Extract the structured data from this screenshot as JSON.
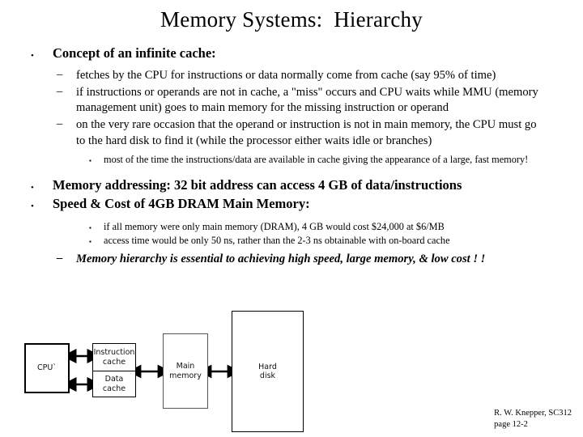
{
  "slide": {
    "title": "Memory Systems:  Hierarchy",
    "background_color": "#ffffff",
    "text_color": "#000000"
  },
  "bullets": {
    "b1": {
      "marker": "•",
      "text_plain": "Concept of an infinite cache:",
      "pre": "Concept of an ",
      "strong": "infinite cache",
      "post": ":"
    },
    "b2": {
      "marker": "–",
      "text": "fetches by the CPU for instructions or data normally come from cache (say 95% of time)"
    },
    "b3": {
      "marker": "–",
      "text": "if instructions or operands are not in cache, a \"miss\" occurs and CPU waits while MMU (memory management unit) goes to main memory for the missing instruction or operand"
    },
    "b4": {
      "marker": "–",
      "text": "on the very rare occasion that the operand or instruction is not in main memory, the CPU must go to the hard disk to find it (while the processor either waits idle or branches)"
    },
    "b5": {
      "marker": "▪",
      "text": "most of the time the instructions/data are available in cache giving the appearance of a large, fast memory!"
    },
    "b6": {
      "marker": "•",
      "text": "Memory addressing:  32 bit address can access 4 GB of data/instructions"
    },
    "b7": {
      "marker": "•",
      "text": "Speed & Cost of 4GB DRAM Main Memory:"
    },
    "b8": {
      "marker": "▪",
      "text": "if all memory were only main memory (DRAM), 4 GB  would cost $24,000 at $6/MB"
    },
    "b9": {
      "marker": "▪",
      "text": "access time would be only 50 ns, rather than the 2-3 ns obtainable with on-board cache"
    },
    "b10": {
      "marker": "–",
      "text": "Memory hierarchy is essential to achieving high speed, large memory, & low cost ! !"
    }
  },
  "diagram": {
    "cpu": {
      "label": "CPU`"
    },
    "instruction_cache": {
      "label": "Instruction\ncache"
    },
    "data_cache": {
      "label": "Data\ncache"
    },
    "main_memory": {
      "label": "Main\nmemory"
    },
    "hard_disk": {
      "label": "Hard\ndisk"
    },
    "connectors": [
      {
        "name": "cpu-to-instruction-cache",
        "type": "double-arrow"
      },
      {
        "name": "cpu-to-data-cache",
        "type": "double-arrow"
      },
      {
        "name": "cache-to-main-memory",
        "type": "double-arrow"
      },
      {
        "name": "main-memory-to-hard-disk",
        "type": "double-arrow"
      }
    ]
  },
  "footer": {
    "line1": "R. W. Knepper, SC312",
    "line2": "page 12-2"
  }
}
